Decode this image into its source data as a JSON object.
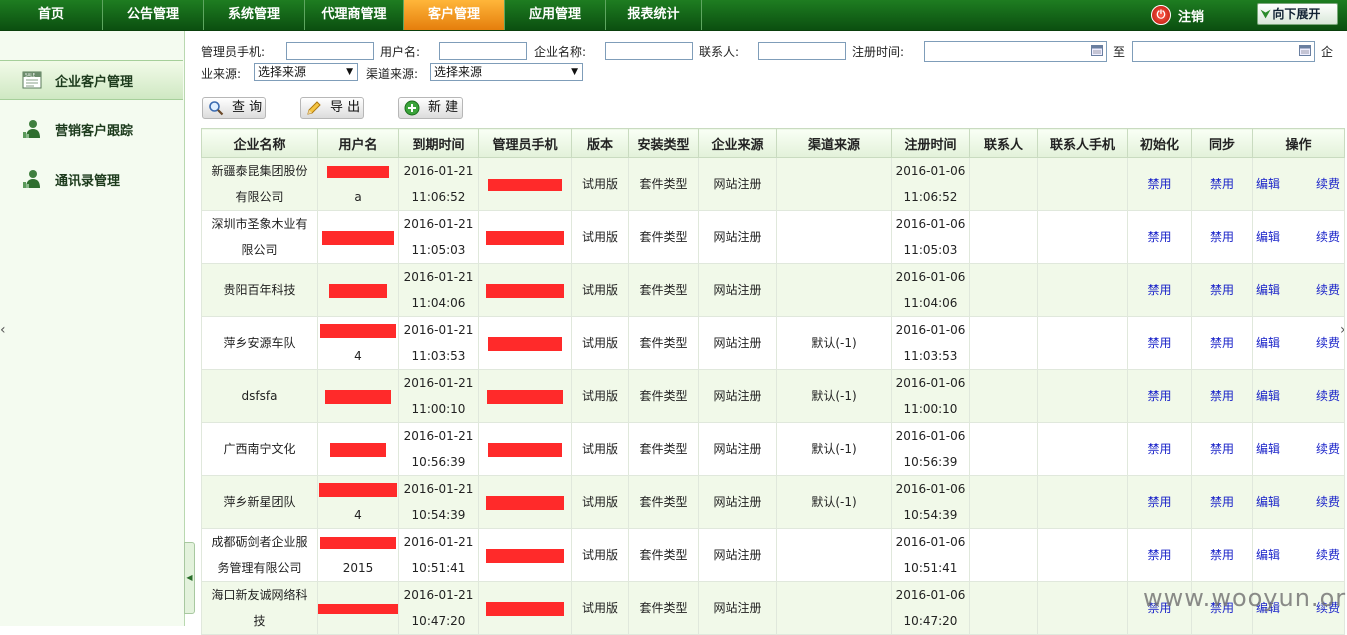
{
  "nav": {
    "items": [
      "首页",
      "公告管理",
      "系统管理",
      "代理商管理",
      "客户管理",
      "应用管理",
      "报表统计"
    ],
    "active_index": 4,
    "logout_label": "注销",
    "expand_label": "向下展开",
    "colors": {
      "bar": "#0b4f10",
      "active": "#f0911e"
    }
  },
  "sidebar": {
    "items": [
      {
        "label": "企业客户管理",
        "icon": "sale-card-icon",
        "active": true
      },
      {
        "label": "营销客户跟踪",
        "icon": "user-chart-icon",
        "active": false
      },
      {
        "label": "通讯录管理",
        "icon": "user-chart-icon",
        "active": false
      }
    ]
  },
  "filters": {
    "admin_phone_label": "管理员手机:",
    "username_label": "用户名:",
    "company_label": "企业名称:",
    "contact_label": "联系人:",
    "regtime_label": "注册时间:",
    "to_label": "至",
    "qi_label": "企",
    "ye_source_label": "业来源:",
    "channel_label": "渠道来源:",
    "source_select": "选择来源",
    "channel_select": "选择来源"
  },
  "actions": {
    "query": "查 询",
    "export": "导 出",
    "new": "新 建"
  },
  "table": {
    "headers": [
      "企业名称",
      "用户名",
      "到期时间",
      "管理员手机",
      "版本",
      "安装类型",
      "企业来源",
      "渠道来源",
      "注册时间",
      "联系人",
      "联系人手机",
      "初始化",
      "同步",
      "操作"
    ],
    "action_labels": {
      "init": "禁用",
      "sync": "禁用",
      "edit": "编辑",
      "renew": "续费"
    },
    "rows": [
      {
        "company": [
          "新疆泰昆集团股份",
          "有限公司"
        ],
        "user_suffix": "a",
        "expire": [
          "2016-01-21",
          "11:06:52"
        ],
        "version": "试用版",
        "install": "套件类型",
        "source": "网站注册",
        "channel": "",
        "reg": [
          "2016-01-06",
          "11:06:52"
        ]
      },
      {
        "company": [
          "深圳市圣象木业有",
          "限公司"
        ],
        "user_suffix": "",
        "expire": [
          "2016-01-21",
          "11:05:03"
        ],
        "version": "试用版",
        "install": "套件类型",
        "source": "网站注册",
        "channel": "",
        "reg": [
          "2016-01-06",
          "11:05:03"
        ]
      },
      {
        "company": [
          "贵阳百年科技"
        ],
        "user_suffix": "",
        "expire": [
          "2016-01-21",
          "11:04:06"
        ],
        "version": "试用版",
        "install": "套件类型",
        "source": "网站注册",
        "channel": "",
        "reg": [
          "2016-01-06",
          "11:04:06"
        ]
      },
      {
        "company": [
          "萍乡安源车队"
        ],
        "user_suffix": "4",
        "expire": [
          "2016-01-21",
          "11:03:53"
        ],
        "version": "试用版",
        "install": "套件类型",
        "source": "网站注册",
        "channel": "默认(-1)",
        "reg": [
          "2016-01-06",
          "11:03:53"
        ]
      },
      {
        "company": [
          "dsfsfa"
        ],
        "user_suffix": "",
        "expire": [
          "2016-01-21",
          "11:00:10"
        ],
        "version": "试用版",
        "install": "套件类型",
        "source": "网站注册",
        "channel": "默认(-1)",
        "reg": [
          "2016-01-06",
          "11:00:10"
        ]
      },
      {
        "company": [
          "广西南宁文化"
        ],
        "user_suffix": "",
        "expire": [
          "2016-01-21",
          "10:56:39"
        ],
        "version": "试用版",
        "install": "套件类型",
        "source": "网站注册",
        "channel": "默认(-1)",
        "reg": [
          "2016-01-06",
          "10:56:39"
        ]
      },
      {
        "company": [
          "萍乡新星团队"
        ],
        "user_suffix": "4",
        "expire": [
          "2016-01-21",
          "10:54:39"
        ],
        "version": "试用版",
        "install": "套件类型",
        "source": "网站注册",
        "channel": "默认(-1)",
        "reg": [
          "2016-01-06",
          "10:54:39"
        ]
      },
      {
        "company": [
          "成都砺剑者企业服",
          "务管理有限公司"
        ],
        "user_suffix": "2015",
        "expire": [
          "2016-01-21",
          "10:51:41"
        ],
        "version": "试用版",
        "install": "套件类型",
        "source": "网站注册",
        "channel": "",
        "reg": [
          "2016-01-06",
          "10:51:41"
        ]
      },
      {
        "company": [
          "海口新友诚网络科",
          "技"
        ],
        "user_suffix": "",
        "expire": [
          "2016-01-21",
          "10:47:20"
        ],
        "version": "试用版",
        "install": "套件类型",
        "source": "网站注册",
        "channel": "",
        "reg": [
          "2016-01-06",
          "10:47:20"
        ]
      }
    ]
  },
  "watermark": "www.wooyun.org"
}
